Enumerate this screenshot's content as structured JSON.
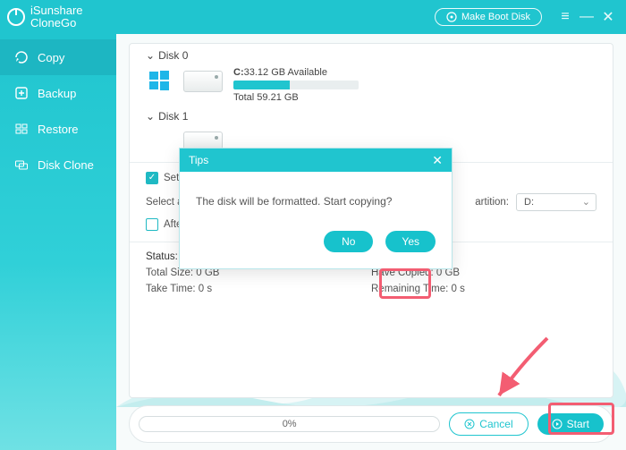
{
  "app": {
    "name": "iSunshare",
    "subname": "CloneGo",
    "boot_btn": "Make Boot Disk"
  },
  "sidebar": {
    "items": [
      {
        "label": "Copy"
      },
      {
        "label": "Backup"
      },
      {
        "label": "Restore"
      },
      {
        "label": "Disk Clone"
      }
    ]
  },
  "disks": {
    "d0": {
      "header": "Disk 0",
      "letter": "C:",
      "avail": "33.12 GB Available",
      "total": "Total 59.21 GB"
    },
    "d1": {
      "header": "Disk 1"
    }
  },
  "options": {
    "set_target": "Set t",
    "select_a": "Select a",
    "after": "After",
    "partition_label": "artition:",
    "combo_value": "D:"
  },
  "status": {
    "heading": "Status:",
    "total": "Total Size: 0 GB",
    "copied": "Have Copied: 0 GB",
    "take": "Take Time: 0 s",
    "remain": "Remaining Time: 0 s"
  },
  "footer": {
    "progress": "0%",
    "cancel": "Cancel",
    "start": "Start"
  },
  "dialog": {
    "title": "Tips",
    "message": "The disk will be formatted. Start copying?",
    "no": "No",
    "yes": "Yes"
  }
}
